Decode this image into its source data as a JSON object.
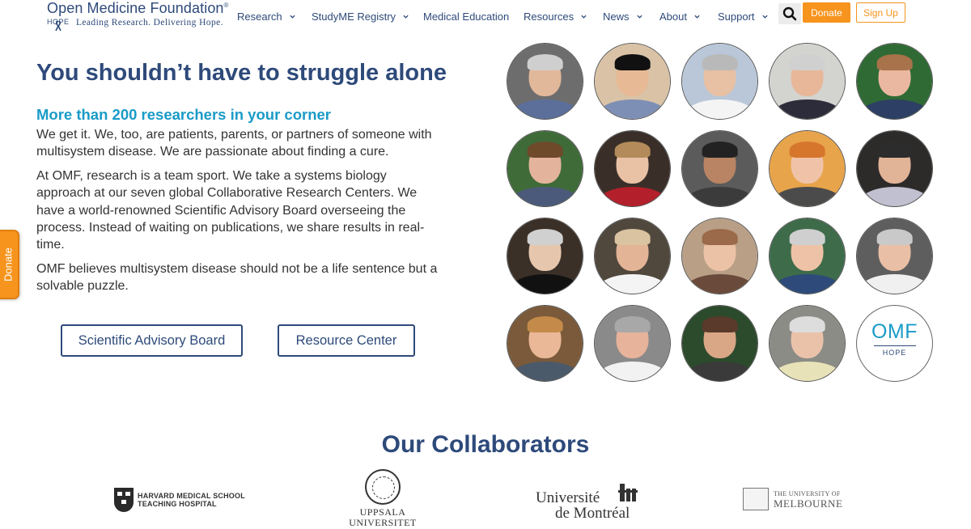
{
  "header": {
    "logo": {
      "title": "Open Medicine Foundation",
      "registered": "®",
      "hope": "HOPE",
      "tagline": "Leading Research. Delivering Hope."
    },
    "nav": [
      {
        "label": "Research",
        "has_dropdown": true
      },
      {
        "label": "StudyME Registry",
        "has_dropdown": true
      },
      {
        "label": "Medical Education",
        "has_dropdown": false
      },
      {
        "label": "Resources",
        "has_dropdown": true
      },
      {
        "label": "News",
        "has_dropdown": true
      },
      {
        "label": "About",
        "has_dropdown": true
      },
      {
        "label": "Support",
        "has_dropdown": true
      }
    ],
    "search_icon": "search-icon",
    "donate_label": "Donate",
    "signup_label": "Sign Up"
  },
  "side_tab": {
    "label": "Donate"
  },
  "hero": {
    "title": "You shouldn’t have to struggle alone",
    "subtitle": "More than 200 researchers in your corner",
    "paragraphs": [
      "We get it. We, too, are patients, parents, or partners of someone with multisystem disease. We are passionate about finding a cure.",
      "At OMF, research is a team sport. We take a systems biology approach at our seven global Collaborative Research Centers. We have a world-renowned Scientific Advisory Board overseeing the process. Instead of waiting on publications, we share results in real-time.",
      "OMF believes multisystem disease should not be a life sentence but a solvable puzzle."
    ],
    "buttons": {
      "advisory_board": "Scientific Advisory Board",
      "resource_center": "Resource Center"
    }
  },
  "researchers": {
    "count": 19,
    "logo": {
      "text": "OMF",
      "hope": "HOPE"
    }
  },
  "collaborators": {
    "title": "Our Collaborators",
    "logos": {
      "harvard_line1": "HARVARD MEDICAL SCHOOL",
      "harvard_line2": "TEACHING HOSPITAL",
      "uppsala_line1": "UPPSALA",
      "uppsala_line2": "UNIVERSITET",
      "montreal_line1": "Université",
      "montreal_line2": "de Montréal",
      "melbourne_line1": "THE UNIVERSITY OF",
      "melbourne_line2": "MELBOURNE"
    }
  },
  "colors": {
    "brand_navy": "#2e4a7a",
    "accent_teal": "#1a9bc7",
    "donate_orange": "#f7941d"
  }
}
